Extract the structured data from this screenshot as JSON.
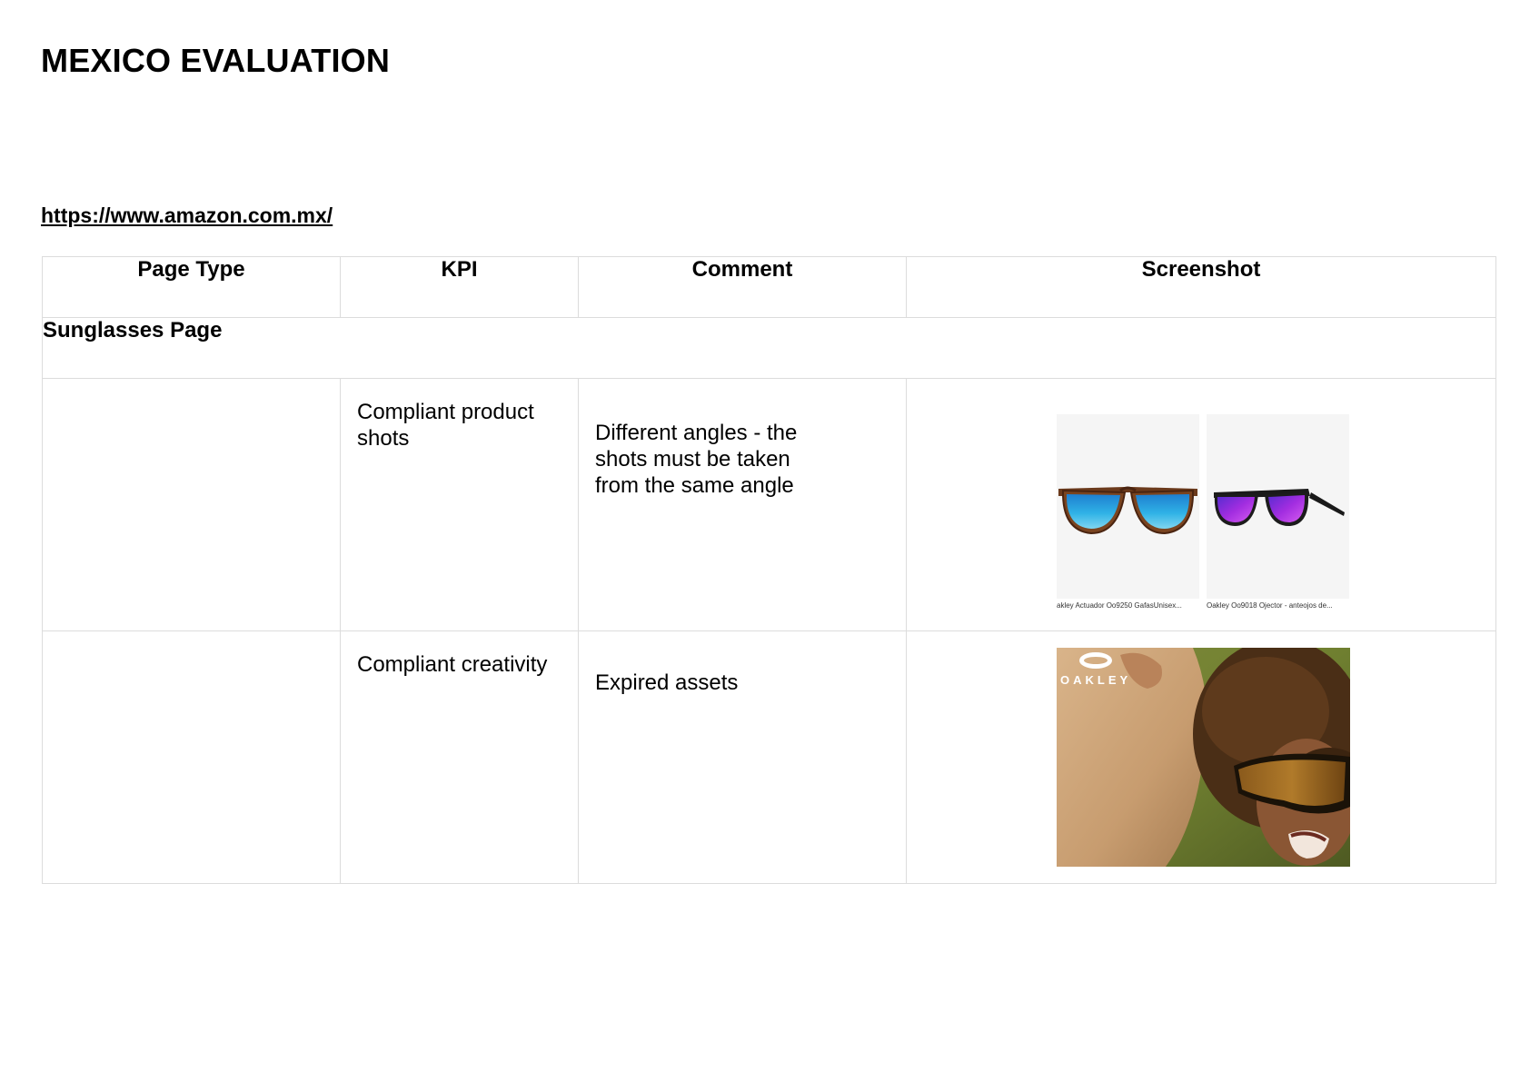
{
  "document": {
    "title": "MEXICO EVALUATION",
    "url": "https://www.amazon.com.mx/"
  },
  "table": {
    "headers": {
      "page_type": "Page Type",
      "kpi": "KPI",
      "comment": "Comment",
      "screenshot": "Screenshot"
    },
    "section": "Sunglasses Page",
    "rows": [
      {
        "page_type": "",
        "kpi": "Compliant product shots",
        "comment": "Different angles - the shots must be taken from the same angle",
        "products": [
          {
            "caption": "akley Actuador Oo9250 GafasUnisex..."
          },
          {
            "caption": "Oakley Oo9018 Ojector - anteojos de..."
          }
        ]
      },
      {
        "page_type": "",
        "kpi": "Compliant creativity",
        "comment": "Expired assets",
        "banner": {
          "logo_text": "OAKLEY"
        }
      }
    ]
  },
  "colors": {
    "border": "#dcdcdc",
    "lens_blue": "#2aa8e0",
    "lens_violet": "#9b2fe0",
    "frame_tortoise": "#6b3a1c"
  }
}
